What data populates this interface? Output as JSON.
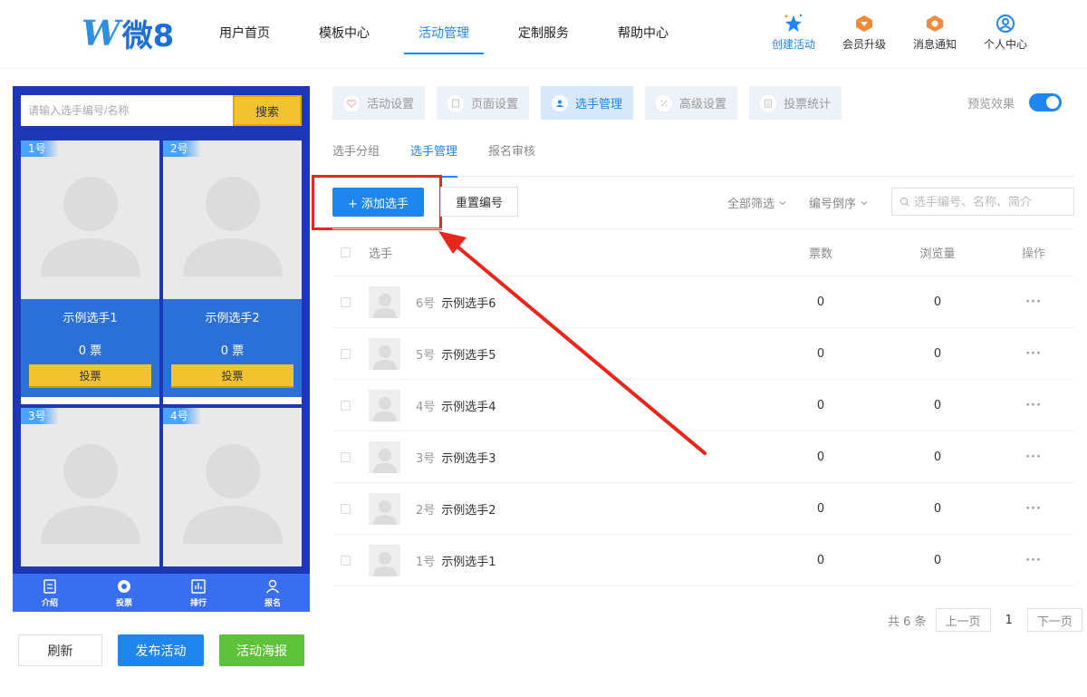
{
  "header": {
    "logo_text": "微8",
    "nav": [
      "用户首页",
      "模板中心",
      "活动管理",
      "定制服务",
      "帮助中心"
    ],
    "tools": {
      "create": "创建活动",
      "upgrade": "会员升级",
      "notify": "消息通知",
      "profile": "个人中心"
    }
  },
  "phone": {
    "search_placeholder": "请输入选手编号/名称",
    "search_button": "搜索",
    "cards": [
      {
        "num": "1号",
        "name": "示例选手1",
        "votes": "0 票",
        "button": "投票"
      },
      {
        "num": "2号",
        "name": "示例选手2",
        "votes": "0 票",
        "button": "投票"
      },
      {
        "num": "3号"
      },
      {
        "num": "4号"
      }
    ],
    "tabbar": [
      "介绍",
      "投票",
      "排行",
      "报名"
    ]
  },
  "actions": {
    "refresh": "刷新",
    "publish": "发布活动",
    "poster": "活动海报"
  },
  "steps": [
    "活动设置",
    "页面设置",
    "选手管理",
    "高级设置",
    "投票统计"
  ],
  "preview_label": "预览效果",
  "subtabs": [
    "选手分组",
    "选手管理",
    "报名审核"
  ],
  "toolbar": {
    "add": "+ 添加选手",
    "renumber": "重置编号",
    "filter_all": "全部筛选",
    "filter_order": "编号倒序",
    "search_placeholder": "选手编号、名称、简介"
  },
  "table": {
    "headers": {
      "player": "选手",
      "votes": "票数",
      "views": "浏览量",
      "ops": "操作"
    },
    "rows": [
      {
        "num": "6号",
        "name": "示例选手6",
        "votes": "0",
        "views": "0",
        "ops": "···"
      },
      {
        "num": "5号",
        "name": "示例选手5",
        "votes": "0",
        "views": "0",
        "ops": "···"
      },
      {
        "num": "4号",
        "name": "示例选手4",
        "votes": "0",
        "views": "0",
        "ops": "···"
      },
      {
        "num": "3号",
        "name": "示例选手3",
        "votes": "0",
        "views": "0",
        "ops": "···"
      },
      {
        "num": "2号",
        "name": "示例选手2",
        "votes": "0",
        "views": "0",
        "ops": "···"
      },
      {
        "num": "1号",
        "name": "示例选手1",
        "votes": "0",
        "views": "0",
        "ops": "···"
      }
    ]
  },
  "pager": {
    "total": "共 6 条",
    "prev": "上一页",
    "current": "1",
    "next": "下一页"
  },
  "colors": {
    "accent": "#1f86f0",
    "highlight": "#e8261c",
    "phone_bg": "#1d37b5",
    "vote_yellow": "#f2c230",
    "poster_green": "#5ec33a"
  }
}
